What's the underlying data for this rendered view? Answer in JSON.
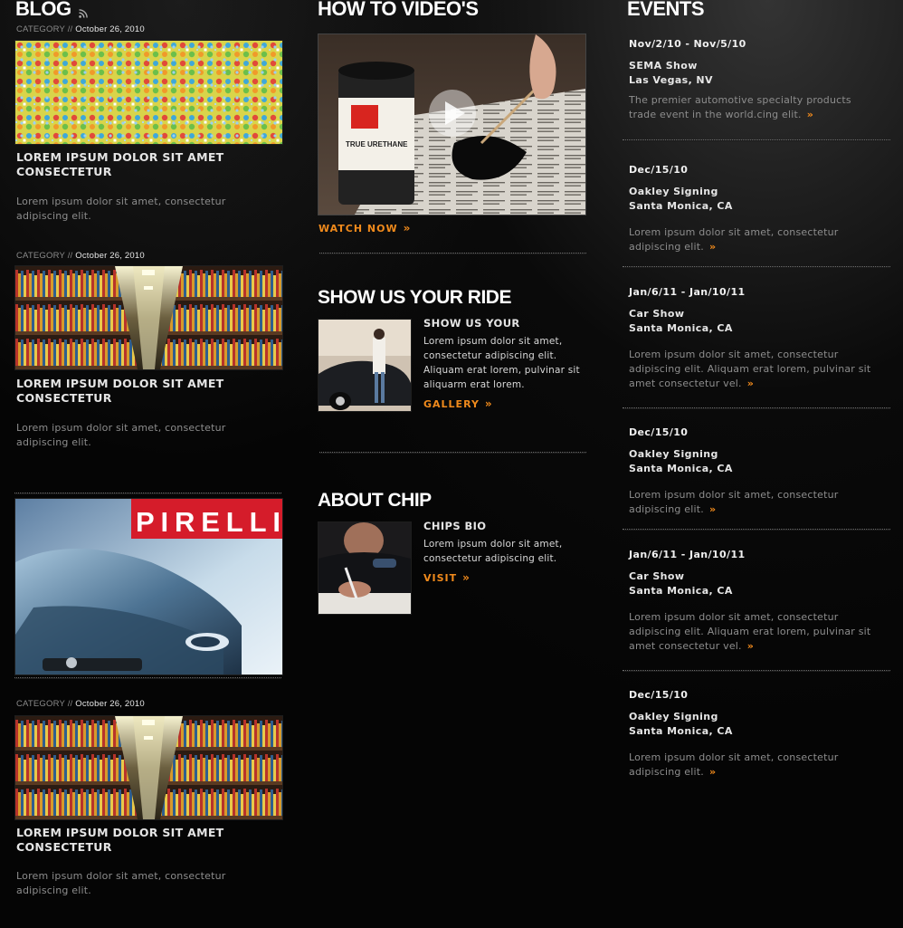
{
  "blog": {
    "heading": "BLOG",
    "posts": [
      {
        "category": "CATEGORY //",
        "date": "October 26, 2010",
        "title": "LOREM IPSUM DOLOR SIT AMET CONSECTETUR",
        "excerpt": "Lorem ipsum dolor sit amet, consectetur adipiscing elit.",
        "image": "colorful-mosaic-image"
      },
      {
        "category": "CATEGORY //",
        "date": "October 26, 2010",
        "title": "LOREM IPSUM DOLOR SIT AMET CONSECTETUR",
        "excerpt": "Lorem ipsum dolor sit amet, consectetur adipiscing elit.",
        "image": "library-bookshelves-image"
      },
      {
        "image": "pirelli-car-ad-image",
        "brand_text": "PIRELLI"
      },
      {
        "category": "CATEGORY //",
        "date": "October 26, 2010",
        "title": "LOREM IPSUM DOLOR SIT AMET CONSECTETUR",
        "excerpt": "Lorem ipsum dolor sit amet, consectetur adipiscing elit.",
        "image": "library-bookshelves-image"
      }
    ]
  },
  "videos": {
    "heading": "HOW TO VIDEO'S",
    "video_image": "paint-can-brush-video-thumbnail",
    "cta": "WATCH NOW"
  },
  "ride": {
    "heading": "SHOW US YOUR RIDE",
    "subtitle": "SHOW US YOUR",
    "body": "Lorem ipsum dolor sit amet, consectetur adipiscing elit. Aliquam erat lorem, pulvinar sit aliquarm erat lorem.",
    "cta": "GALLERY"
  },
  "about": {
    "heading": "ABOUT CHIP",
    "subtitle": "CHIPS BIO",
    "body": "Lorem ipsum dolor sit amet, consectetur adipiscing elit.",
    "cta": "VISIT"
  },
  "events": {
    "heading": "EVENTS",
    "items": [
      {
        "date": "Nov/2/10 - Nov/5/10",
        "name": "SEMA Show",
        "location": "Las Vegas, NV",
        "desc": "The premier automotive specialty products trade event in the world.cing elit."
      },
      {
        "date": "Dec/15/10",
        "name": "Oakley Signing",
        "location": "Santa Monica, CA",
        "desc": "Lorem ipsum dolor sit amet, consectetur adipiscing elit."
      },
      {
        "date": "Jan/6/11 - Jan/10/11",
        "name": "Car Show",
        "location": "Santa Monica, CA",
        "desc": "Lorem ipsum dolor sit amet, consectetur adipiscing elit. Aliquam erat lorem, pulvinar sit amet consectetur vel."
      },
      {
        "date": "Dec/15/10",
        "name": "Oakley Signing",
        "location": "Santa Monica, CA",
        "desc": "Lorem ipsum dolor sit amet, consectetur adipiscing elit."
      },
      {
        "date": "Jan/6/11 - Jan/10/11",
        "name": "Car Show",
        "location": "Santa Monica, CA",
        "desc": "Lorem ipsum dolor sit amet, consectetur adipiscing elit. Aliquam erat lorem, pulvinar sit amet consectetur vel."
      },
      {
        "date": "Dec/15/10",
        "name": "Oakley Signing",
        "location": "Santa Monica, CA",
        "desc": "Lorem ipsum dolor sit amet, consectetur adipiscing elit."
      }
    ],
    "arrow_glyph": "»"
  },
  "colors": {
    "accent": "#f08a1c",
    "background": "#050505",
    "text": "#e5e5e5",
    "muted": "#8d8d8d"
  },
  "icons": {
    "rss": "rss-icon",
    "play": "play-icon",
    "arrow": "double-chevron-right-icon"
  }
}
